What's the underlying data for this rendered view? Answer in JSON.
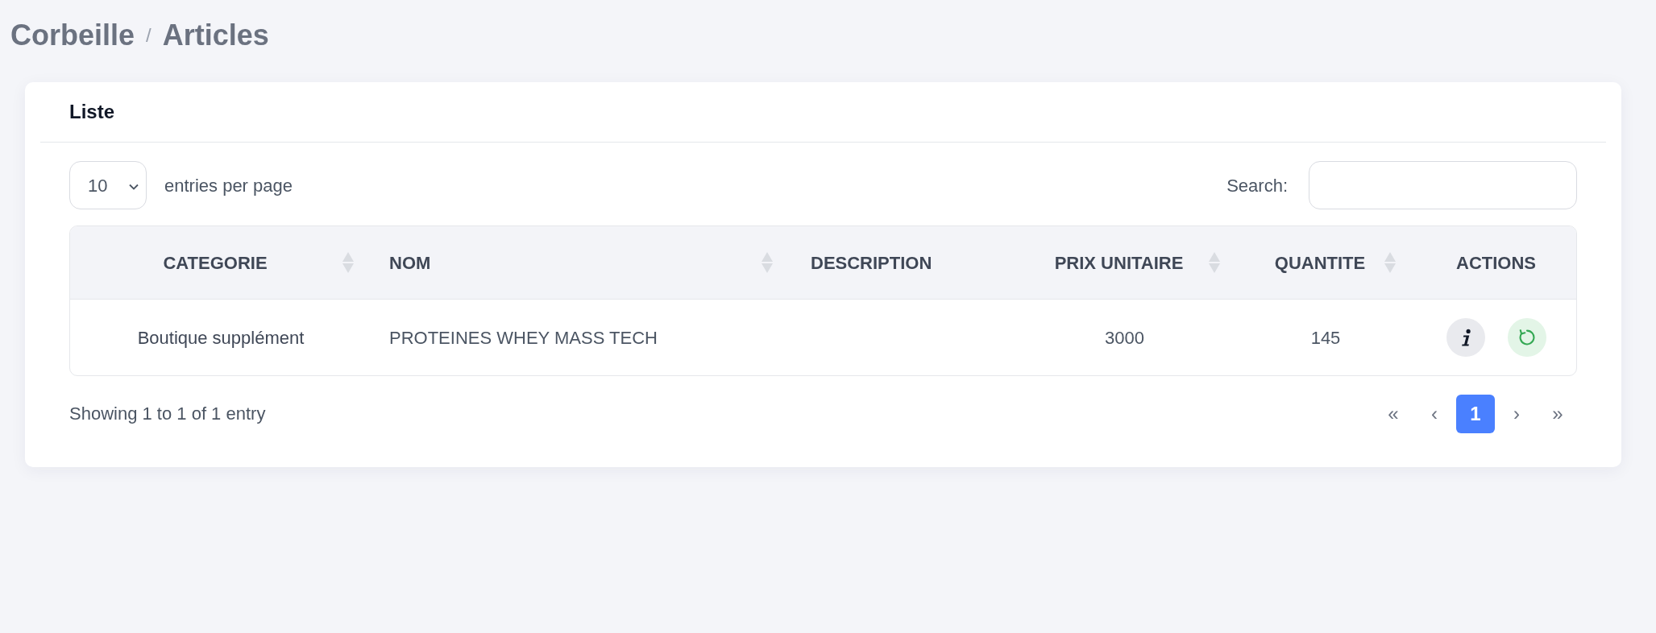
{
  "breadcrumb": {
    "items": [
      {
        "label": "Corbeille"
      },
      {
        "label": "Articles"
      }
    ],
    "separator": "/"
  },
  "card": {
    "title": "Liste",
    "page_size": {
      "value": "10",
      "label": "entries per page"
    },
    "search": {
      "label": "Search:"
    },
    "table": {
      "columns": [
        {
          "label": "CATEGORIE",
          "sortable": true
        },
        {
          "label": "NOM",
          "sortable": true
        },
        {
          "label": "DESCRIPTION",
          "sortable": false
        },
        {
          "label": "PRIX UNITAIRE",
          "sortable": true
        },
        {
          "label": "QUANTITE",
          "sortable": true
        },
        {
          "label": "ACTIONS",
          "sortable": false
        }
      ],
      "rows": [
        {
          "category": "Boutique supplément",
          "name": "PROTEINES WHEY MASS TECH",
          "unit_price": "3000",
          "quantity": "145",
          "actions": [
            {
              "kind": "info"
            },
            {
              "kind": "restore"
            }
          ]
        }
      ]
    },
    "summary": "Showing 1 to 1 of 1 entry",
    "pagination": [
      {
        "label": "«",
        "selected": false
      },
      {
        "label": "‹",
        "selected": false
      },
      {
        "label": "1",
        "selected": true
      },
      {
        "label": "›",
        "selected": false
      },
      {
        "label": "»",
        "selected": false
      }
    ]
  }
}
